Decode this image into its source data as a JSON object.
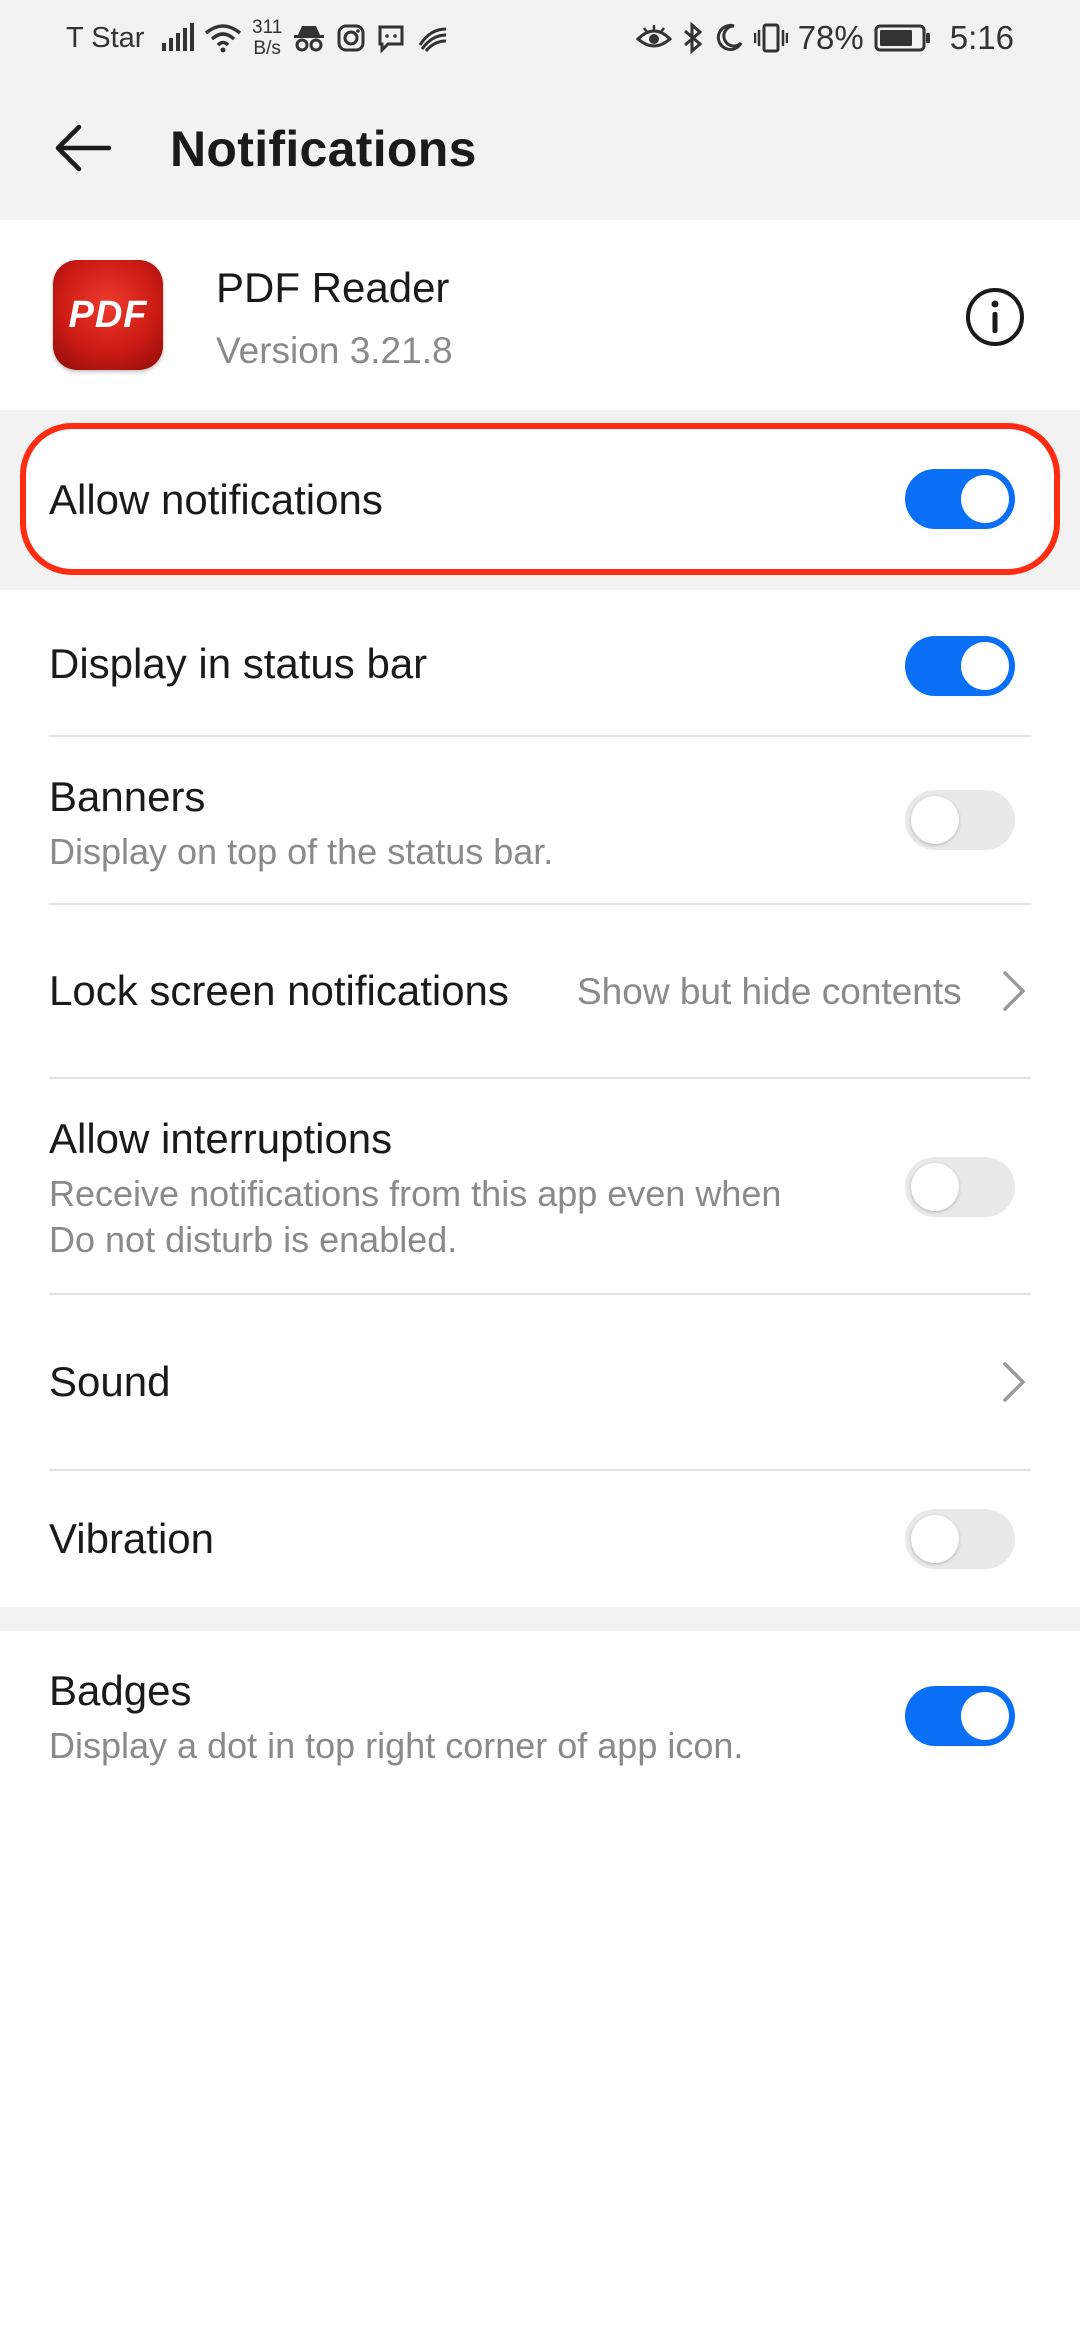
{
  "status_bar": {
    "carrier": "T Star",
    "net_speed_value": "311",
    "net_speed_unit": "B/s",
    "battery": "78%",
    "time": "5:16",
    "icons": [
      "signal-icon",
      "wifi-icon",
      "incognito-icon",
      "instagram-icon",
      "message-icon",
      "swipe-icon",
      "eye-icon",
      "bluetooth-icon",
      "moon-icon",
      "vibrate-icon",
      "battery-icon"
    ]
  },
  "header": {
    "title": "Notifications"
  },
  "app": {
    "name": "PDF Reader",
    "version": "Version 3.21.8",
    "icon_text": "PDF"
  },
  "settings": {
    "allow_notifications": {
      "label": "Allow notifications",
      "enabled": true
    },
    "display_in_status_bar": {
      "label": "Display in status bar",
      "enabled": true
    },
    "banners": {
      "label": "Banners",
      "description": "Display on top of the status bar.",
      "enabled": false
    },
    "lock_screen": {
      "label": "Lock screen notifications",
      "value": "Show but hide contents"
    },
    "allow_interruptions": {
      "label": "Allow interruptions",
      "description_line1": "Receive notifications from this app even when",
      "description_line2": "Do not disturb is enabled.",
      "enabled": false
    },
    "sound": {
      "label": "Sound"
    },
    "vibration": {
      "label": "Vibration",
      "enabled": false
    },
    "badges": {
      "label": "Badges",
      "description": "Display a dot in top right corner of app icon.",
      "enabled": true
    }
  },
  "colors": {
    "accent": "#0a6ff7",
    "highlight_border": "#ff2c12",
    "toggle_off": "#e9e9e9",
    "secondary_text": "#8a8a8a"
  }
}
